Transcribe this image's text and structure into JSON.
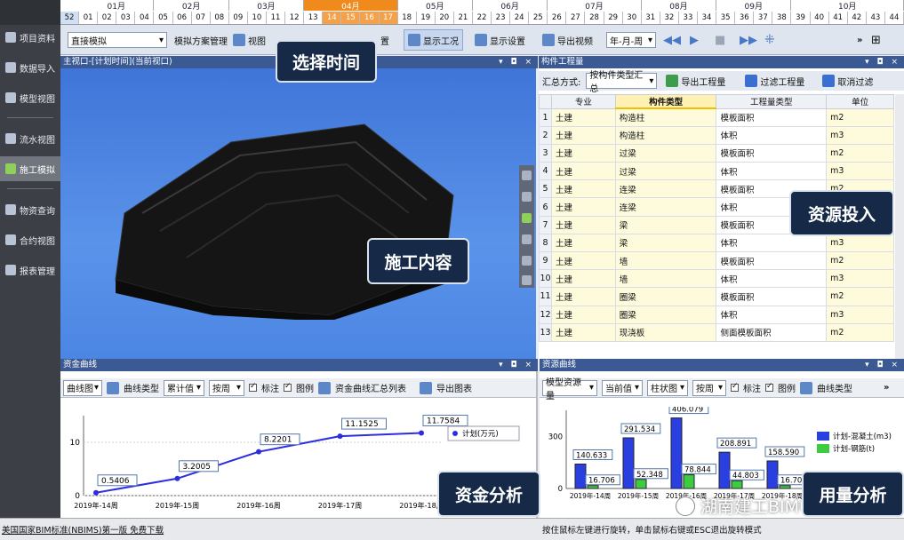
{
  "sidebar": {
    "items": [
      {
        "label": "项目资料",
        "icon": "folder-icon"
      },
      {
        "label": "数据导入",
        "icon": "import-icon"
      },
      {
        "label": "模型视图",
        "icon": "model-icon"
      },
      {
        "label": "流水视图",
        "icon": "flow-icon"
      },
      {
        "label": "施工模拟",
        "icon": "construction-icon",
        "active": true
      },
      {
        "label": "物资查询",
        "icon": "materials-icon"
      },
      {
        "label": "合约视图",
        "icon": "contract-icon"
      },
      {
        "label": "报表管理",
        "icon": "report-icon"
      }
    ]
  },
  "timeline": {
    "months": [
      "01月",
      "02月",
      "03月",
      "04月",
      "05月",
      "06月",
      "07月",
      "08月",
      "09月",
      "10月"
    ],
    "selected_month": "04月",
    "weeks": [
      "52",
      "01",
      "02",
      "03",
      "04",
      "05",
      "06",
      "07",
      "08",
      "09",
      "10",
      "11",
      "12",
      "13",
      "14",
      "15",
      "16",
      "17",
      "18",
      "19",
      "20",
      "21",
      "22",
      "23",
      "24",
      "25",
      "26",
      "27",
      "28",
      "29",
      "30",
      "31",
      "32",
      "33",
      "34",
      "35",
      "36",
      "37",
      "38",
      "39",
      "40",
      "41",
      "42",
      "43",
      "44"
    ],
    "selected_weeks": [
      "14",
      "15",
      "16",
      "17"
    ]
  },
  "toolbar": {
    "mode_select": "直接模拟",
    "scheme_manage": "模拟方案管理",
    "view": "视图",
    "settings_partial": "置",
    "show_status": "显示工况",
    "show_settings": "显示设置",
    "export_video": "导出视频",
    "date_format": "年-月-周",
    "more": "»"
  },
  "viewport": {
    "title": "主视口-[计划时间](当前视口)",
    "controls": "▾ ◘ ×"
  },
  "quantity_panel": {
    "title": "构件工程量",
    "summary_label": "汇总方式:",
    "summary_value": "按构件类型汇总",
    "export_button": "导出工程量",
    "filter_button": "过滤工程量",
    "cancel_filter_button": "取消过滤",
    "columns": [
      "专业",
      "构件类型",
      "工程量类型",
      "单位"
    ],
    "rows": [
      [
        "1",
        "土建",
        "构造柱",
        "模板面积",
        "m2"
      ],
      [
        "2",
        "土建",
        "构造柱",
        "体积",
        "m3"
      ],
      [
        "3",
        "土建",
        "过梁",
        "模板面积",
        "m2"
      ],
      [
        "4",
        "土建",
        "过梁",
        "体积",
        "m3"
      ],
      [
        "5",
        "土建",
        "连梁",
        "模板面积",
        "m2"
      ],
      [
        "6",
        "土建",
        "连梁",
        "体积",
        "m3"
      ],
      [
        "7",
        "土建",
        "梁",
        "模板面积",
        "m2"
      ],
      [
        "8",
        "土建",
        "梁",
        "体积",
        "m3"
      ],
      [
        "9",
        "土建",
        "墙",
        "模板面积",
        "m2"
      ],
      [
        "10",
        "土建",
        "墙",
        "体积",
        "m3"
      ],
      [
        "11",
        "土建",
        "圈梁",
        "模板面积",
        "m2"
      ],
      [
        "12",
        "土建",
        "圈梁",
        "体积",
        "m3"
      ],
      [
        "13",
        "土建",
        "现浇板",
        "侧面模板面积",
        "m2"
      ]
    ]
  },
  "fund_panel": {
    "title": "资金曲线",
    "chart_select": "曲线图",
    "curve_type": "曲线类型",
    "accumulate_select": "累计值",
    "period_select": "按周",
    "label_check": "标注",
    "legend_check": "图例",
    "summary_button": "资金曲线汇总列表",
    "export_button": "导出图表"
  },
  "resource_panel": {
    "title": "资源曲线",
    "model_select": "模型资源量",
    "current_select": "当前值",
    "bar_select": "柱状图",
    "period_select": "按周",
    "label_check": "标注",
    "legend_check": "图例",
    "curve_type": "曲线类型",
    "more": "»"
  },
  "chart_data": [
    {
      "type": "line",
      "x": [
        "2019年-14周",
        "2019年-15周",
        "2019年-16周",
        "2019年-17周",
        "2019年-18周"
      ],
      "series": [
        {
          "name": "计划(万元)",
          "values": [
            0.5406,
            3.2005,
            8.2201,
            11.1525,
            11.7584
          ]
        }
      ],
      "ylim": [
        0,
        15
      ],
      "yticks": [
        "0",
        "10"
      ],
      "legend": "top-right",
      "color": "#2d2de0"
    },
    {
      "type": "bar",
      "categories": [
        "2019年-14周",
        "2019年-15周",
        "2019年-16周",
        "2019年-17周",
        "2019年-18周"
      ],
      "series": [
        {
          "name": "计划-混凝土(m3)",
          "values": [
            140.633,
            291.534,
            406.079,
            208.891,
            158.59
          ],
          "color": "#2a3fe0"
        },
        {
          "name": "计划-钢筋(t)",
          "values": [
            16.706,
            52.348,
            78.844,
            44.803,
            16.7
          ],
          "color": "#3dcc3d"
        }
      ],
      "value_labels": [
        "140.633",
        "16.706",
        "291.534",
        "52.348",
        "406.079",
        "78.844",
        "208.891",
        "44.803",
        "158.590",
        "16.70"
      ],
      "ylim": [
        0,
        450
      ],
      "yticks": [
        "300",
        "0"
      ],
      "legend": "top-right"
    }
  ],
  "statusbar": {
    "left": "美国国家BIM标准(NBIMS)第一版 免费下载",
    "right": "按住鼠标左键进行旋转，单击鼠标右键或ESC退出旋转模式"
  },
  "watermark": "湖南建工BIM中心",
  "callouts": {
    "time": "选择时间",
    "content": "施工内容",
    "resource": "资源投入",
    "fund": "资金分析",
    "usage": "用量分析"
  }
}
